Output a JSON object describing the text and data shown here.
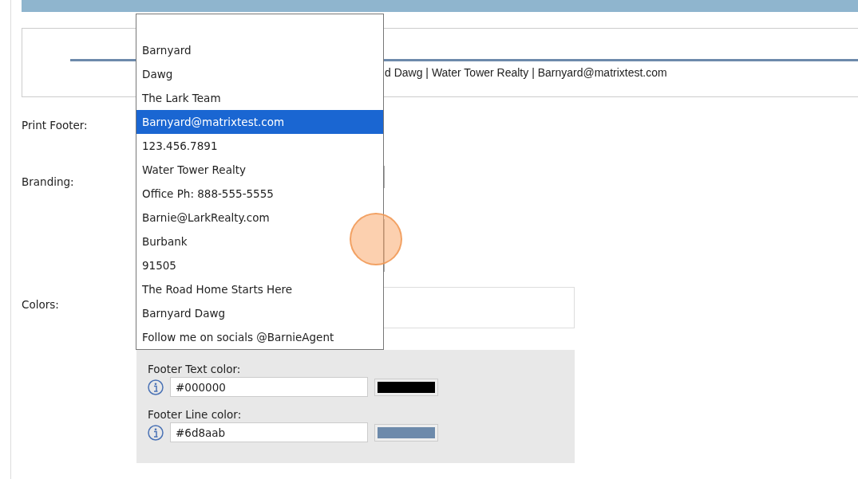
{
  "preview": {
    "footer_text": "d Dawg | Water Tower Realty | Barnyard@matrixtest.com"
  },
  "form": {
    "labels": [
      "Print Footer:",
      "Branding:",
      "Colors:"
    ]
  },
  "dropdown": {
    "options": [
      {
        "label": "Barnyard",
        "selected": false
      },
      {
        "label": "Dawg",
        "selected": false
      },
      {
        "label": "The Lark Team",
        "selected": false
      },
      {
        "label": "Barnyard@matrixtest.com",
        "selected": true
      },
      {
        "label": "123.456.7891",
        "selected": false
      },
      {
        "label": "Water Tower Realty",
        "selected": false
      },
      {
        "label": "Office Ph: 888-555-5555",
        "selected": false
      },
      {
        "label": "Barnie@LarkRealty.com",
        "selected": false
      },
      {
        "label": "Burbank",
        "selected": false
      },
      {
        "label": "91505",
        "selected": false
      },
      {
        "label": "The Road Home Starts Here",
        "selected": false
      },
      {
        "label": "Barnyard Dawg",
        "selected": false
      },
      {
        "label": "Follow me on socials @BarnieAgent",
        "selected": false
      }
    ]
  },
  "colors": [
    {
      "label": "Footer Text color:",
      "value": "#000000",
      "color": "#000000"
    },
    {
      "label": "Footer Line color:",
      "value": "#6d8aab",
      "color": "#6d8aab"
    }
  ]
}
